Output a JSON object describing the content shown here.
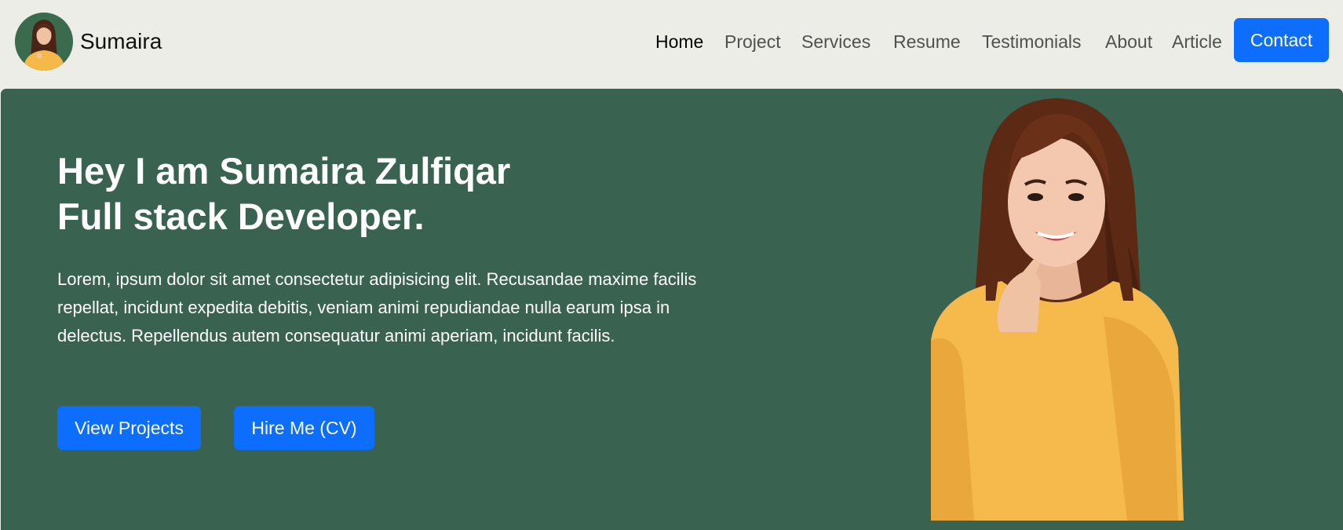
{
  "brand": {
    "name": "Sumaira",
    "avatar": "profile-avatar"
  },
  "nav": {
    "links": [
      {
        "label": "Home",
        "active": true
      },
      {
        "label": "Project"
      },
      {
        "label": "Services"
      },
      {
        "label": "Resume"
      },
      {
        "label": "Testimonials"
      },
      {
        "label": "About"
      },
      {
        "label": "Article"
      }
    ],
    "contact_label": "Contact"
  },
  "hero": {
    "title_line1": "Hey I am Sumaira Zulfiqar",
    "title_line2": "Full stack Developer.",
    "description": "Lorem, ipsum dolor sit amet consectetur adipisicing elit. Recusandae maxime facilis repellat, incidunt expedita debitis, veniam animi repudiandae nulla earum ipsa in delectus. Repellendus autem consequatur animi aperiam, incidunt facilis.",
    "view_projects_label": "View Projects",
    "hire_me_label": "Hire Me (CV)",
    "portrait": "portrait-photo"
  },
  "colors": {
    "page_bg": "#ebede6",
    "hero_bg": "#396350",
    "accent": "#0d6efd"
  }
}
